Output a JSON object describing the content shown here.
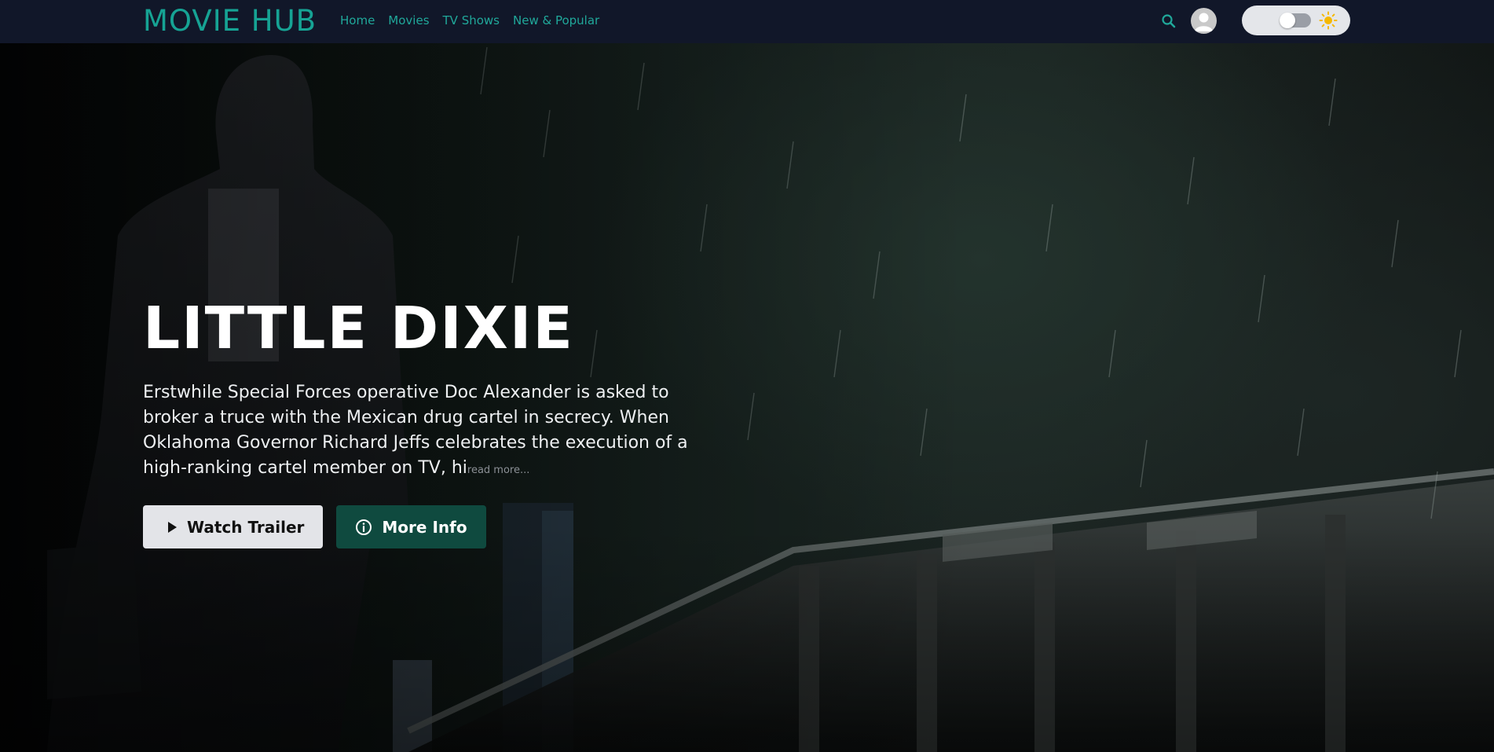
{
  "navbar": {
    "logo": "MOVIE HUB",
    "links": [
      {
        "label": "Home"
      },
      {
        "label": "Movies"
      },
      {
        "label": "TV Shows"
      },
      {
        "label": "New & Popular"
      }
    ],
    "search_icon": "search-icon",
    "avatar_icon": "user-avatar-icon",
    "theme_toggle": {
      "left_icon": "moon-icon",
      "right_icon": "sun-icon",
      "state": "dark"
    }
  },
  "hero": {
    "title": "LITTLE DIXIE",
    "overview": "Erstwhile Special Forces operative Doc Alexander is asked to broker a truce with the Mexican drug cartel in secrecy. When Oklahoma Governor Richard Jeffs celebrates the execution of a high-ranking cartel member on TV, hi",
    "read_more": "read more...",
    "buttons": {
      "trailer": {
        "label": "Watch Trailer",
        "icon": "play-icon"
      },
      "info": {
        "label": "More Info",
        "icon": "info-icon"
      }
    }
  },
  "colors": {
    "brand": "#16a394",
    "navbar_bg": "#111729",
    "info_button_bg": "#0f4a3f",
    "trailer_button_bg": "#e3e4e8",
    "sun": "#f5b800"
  }
}
